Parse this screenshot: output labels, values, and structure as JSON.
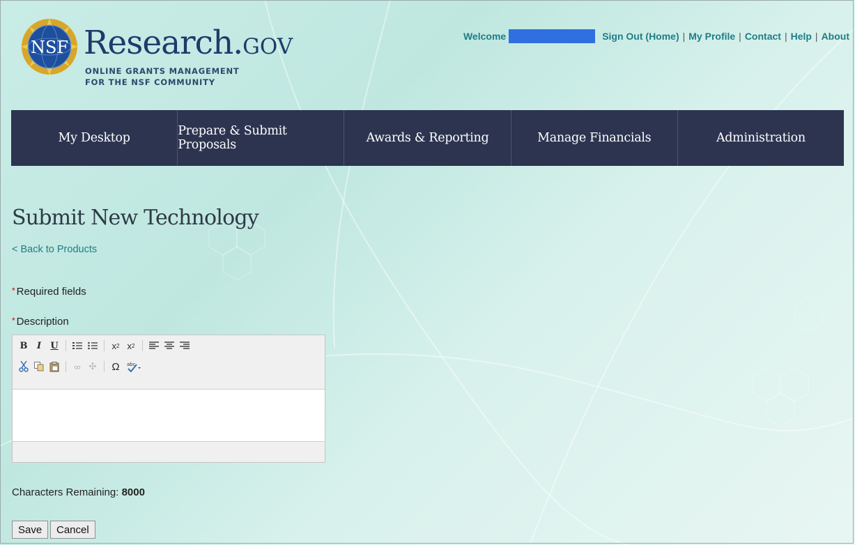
{
  "header": {
    "seal_text": "NSF",
    "brand_name": "Research.",
    "brand_suffix": "GOV",
    "brand_tagline_line1": "ONLINE GRANTS MANAGEMENT",
    "brand_tagline_line2": "FOR THE NSF COMMUNITY"
  },
  "top_nav": {
    "welcome": "Welcome",
    "links": [
      "Sign Out (Home)",
      "My Profile",
      "Contact",
      "Help",
      "About"
    ]
  },
  "main_nav": [
    "My Desktop",
    "Prepare & Submit Proposals",
    "Awards & Reporting",
    "Manage Financials",
    "Administration"
  ],
  "page": {
    "title": "Submit New Technology",
    "back_link": "< Back to Products",
    "required_marker": "*",
    "required_note": "Required fields",
    "description_label": "Description",
    "chars_label": "Characters Remaining:",
    "chars_value": "8000",
    "save": "Save",
    "cancel": "Cancel"
  },
  "colors": {
    "nav_bg": "#2c3450",
    "link": "#1f7d86",
    "brand": "#1d3b6b",
    "redaction": "#2f6fe0"
  }
}
